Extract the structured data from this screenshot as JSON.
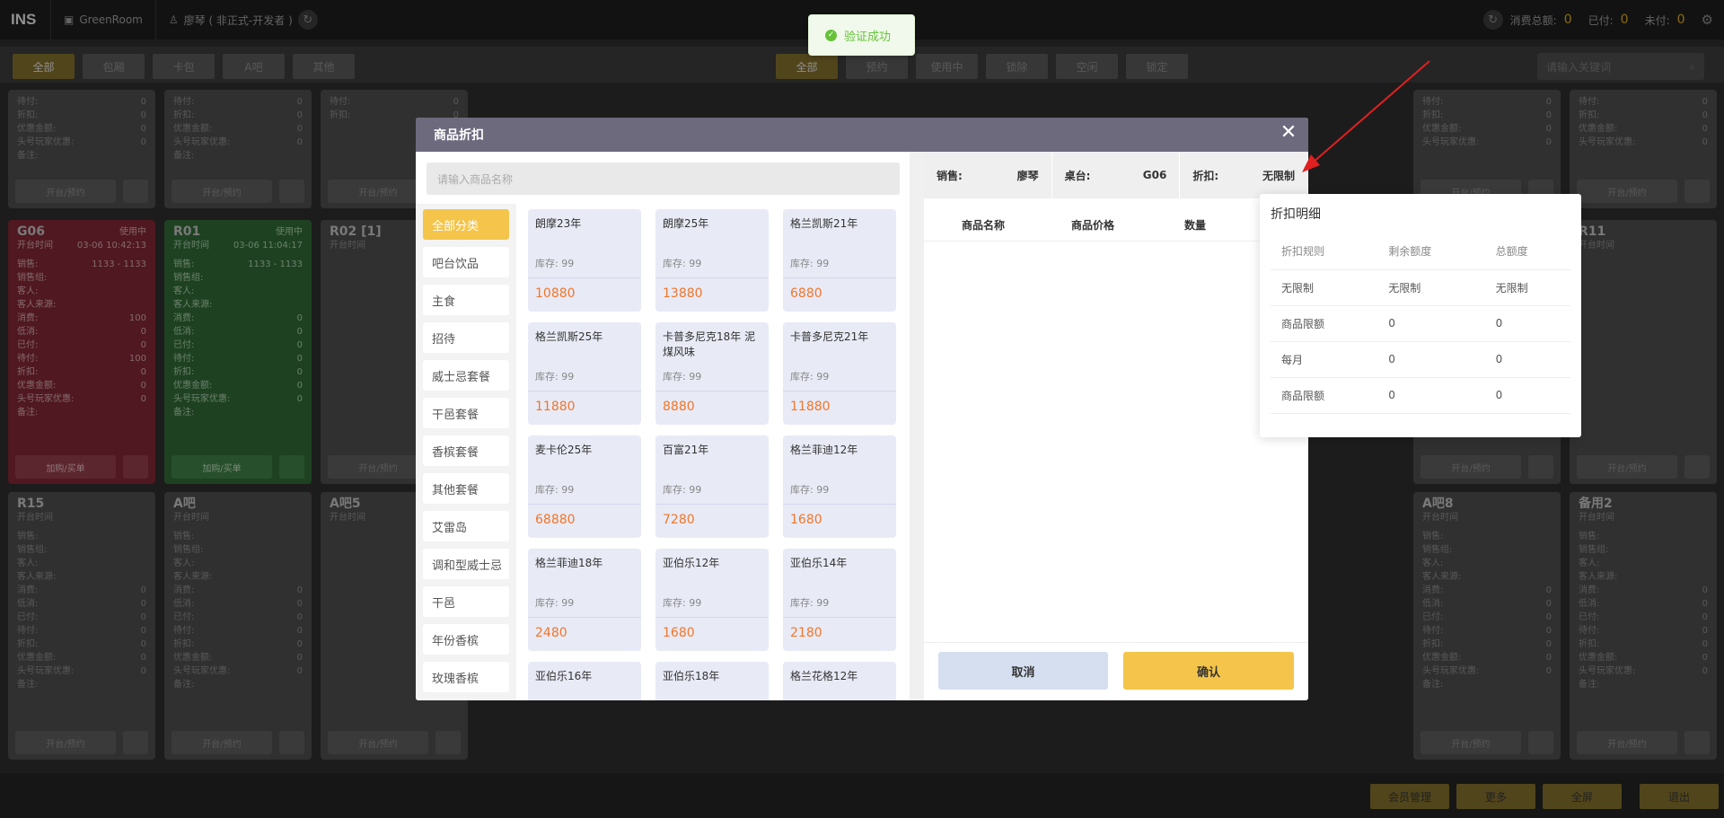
{
  "topbar": {
    "logo": "INS",
    "store": "GreenRoom",
    "user": "廖琴 ( 非正式-开发者 )",
    "total_label": "消费总额:",
    "total_value": "0",
    "paid_label": "已付:",
    "paid_value": "0",
    "unpaid_label": "未付:",
    "unpaid_value": "0"
  },
  "filters": {
    "type_buttons": [
      "全部",
      "包厢",
      "卡包",
      "A吧",
      "其他"
    ],
    "status_buttons": [
      "全部",
      "预约",
      "使用中",
      "锁除",
      "空闲",
      "锁定"
    ],
    "search_placeholder": "请输入关键词"
  },
  "toast": {
    "text": "验证成功"
  },
  "cards": [
    {
      "name": "G06",
      "badge": "使用中",
      "time_label": "开台时间",
      "time": "03-06 10:42:13",
      "button": "加购/买单"
    },
    {
      "name": "R01",
      "badge": "使用中",
      "time_label": "开台时间",
      "time": "03-06 11:04:17",
      "button": "加购/买单"
    },
    {
      "name": "R02 [1]",
      "time_label": "开台时间",
      "button": "开台/预约"
    },
    {
      "name": "R11",
      "time_label": "开台时间",
      "button": "开台/预约"
    },
    {
      "name": "R15",
      "time_label": "开台时间",
      "button": "开台/预约"
    },
    {
      "name": "A吧",
      "time_label": "开台时间",
      "button": "开台/预约"
    },
    {
      "name": "A吧5",
      "time_label": "开台时间",
      "button": "开台/预约"
    },
    {
      "name": "A吧8",
      "time_label": "开台时间",
      "button": "开台/预约"
    },
    {
      "name": "备用2",
      "time_label": "开台时间",
      "button": "开台/预约"
    }
  ],
  "card_fields": [
    "销售:",
    "销售组:",
    "客人:",
    "客人来源:",
    "消费:",
    "低消:",
    "已付:",
    "待付:",
    "折扣:",
    "优惠金额:",
    "头号玩家优惠:",
    "备注:"
  ],
  "card_top_fields": [
    "待付:",
    "折扣:",
    "优惠金额:",
    "头号玩家优惠:",
    "备注:"
  ],
  "g06_amounts": "1133 - 1133",
  "dialog": {
    "title": "商品折扣",
    "search_placeholder": "请输入商品名称",
    "categories": [
      "全部分类",
      "吧台饮品",
      "主食",
      "招待",
      "威士忌套餐",
      "干邑套餐",
      "香槟套餐",
      "其他套餐",
      "艾雷岛",
      "调和型威士忌",
      "干邑",
      "年份香槟",
      "玫瑰香槟"
    ],
    "stock_label": "库存: 99",
    "products": [
      {
        "name": "朗摩23年",
        "price": "10880"
      },
      {
        "name": "朗摩25年",
        "price": "13880"
      },
      {
        "name": "格兰凯斯21年",
        "price": "6880"
      },
      {
        "name": "格兰凯斯25年",
        "price": "11880"
      },
      {
        "name": "卡普多尼克18年 泥煤风味",
        "price": "8880"
      },
      {
        "name": "卡普多尼克21年",
        "price": "11880"
      },
      {
        "name": "麦卡伦25年",
        "price": "68880"
      },
      {
        "name": "百富21年",
        "price": "7280"
      },
      {
        "name": "格兰菲迪12年",
        "price": "1680"
      },
      {
        "name": "格兰菲迪18年",
        "price": "2480"
      },
      {
        "name": "亚伯乐12年",
        "price": "1680"
      },
      {
        "name": "亚伯乐14年",
        "price": "2180"
      },
      {
        "name": "亚伯乐16年",
        "price": ""
      },
      {
        "name": "亚伯乐18年",
        "price": ""
      },
      {
        "name": "格兰花格12年",
        "price": ""
      }
    ],
    "info": {
      "sales_label": "销售:",
      "sales_value": "廖琴",
      "table_label": "桌台:",
      "table_value": "G06",
      "discount_label": "折扣:",
      "discount_value": "无限制"
    },
    "columns": [
      "商品名称",
      "商品价格",
      "数量"
    ],
    "cancel": "取消",
    "confirm": "确认"
  },
  "popover": {
    "title": "折扣明细",
    "headers": [
      "折扣规则",
      "剩余额度",
      "总额度"
    ],
    "rows": [
      [
        "无限制",
        "无限制",
        "无限制"
      ],
      [
        "商品限额",
        "0",
        "0"
      ],
      [
        "每月",
        "0",
        "0"
      ],
      [
        "商品限额",
        "0",
        "0"
      ]
    ]
  },
  "bottom": {
    "buttons": [
      "会员管理",
      "更多",
      "全屏",
      "退出"
    ]
  },
  "colors": {
    "accent": "#f4c54a",
    "price": "#f0762a",
    "dialog_header": "#6d6a7e",
    "arrow": "#e02020"
  }
}
